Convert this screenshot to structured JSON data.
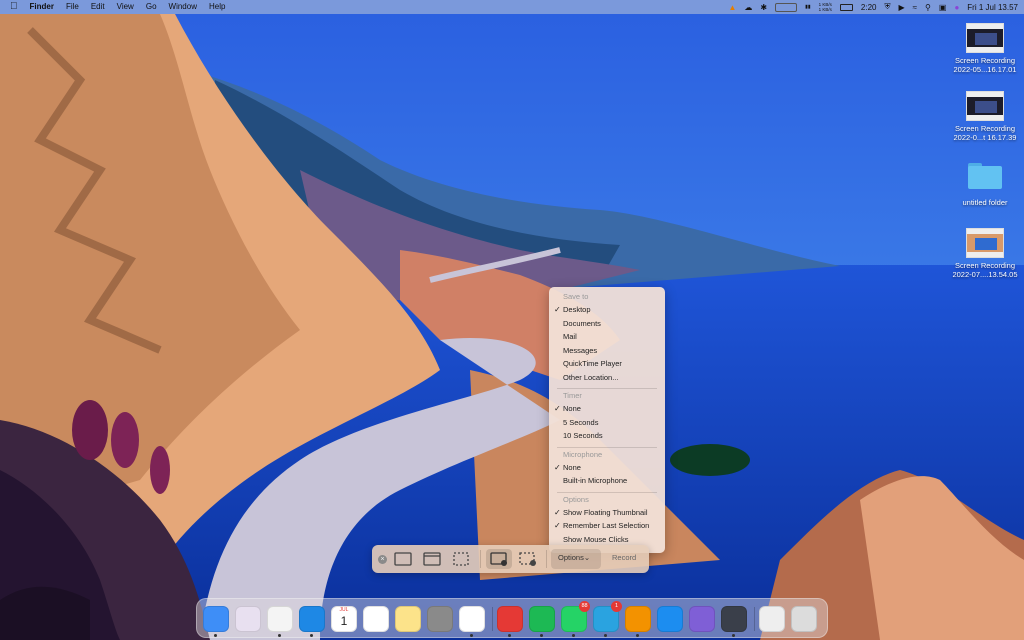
{
  "menubar": {
    "app_name": "Finder",
    "menus": [
      "File",
      "Edit",
      "View",
      "Go",
      "Window",
      "Help"
    ],
    "status": {
      "net_up": "1 KB/s",
      "net_down": "1 KB/s",
      "battery_time": "2:20",
      "datetime": "Fri 1 Jul  13.57"
    }
  },
  "desktop_items": [
    {
      "line1": "Screen Recording",
      "line2": "2022-05...16.17.01",
      "kind": "recording"
    },
    {
      "line1": "Screen Recording",
      "line2": "2022-0...t 16.17.39",
      "kind": "recording"
    },
    {
      "line1": "untitled folder",
      "line2": "",
      "kind": "folder"
    },
    {
      "line1": "Screen Recording",
      "line2": "2022-07....13.54.05",
      "kind": "recording"
    }
  ],
  "options_menu": {
    "save_to": {
      "header": "Save to",
      "items": [
        "Desktop",
        "Documents",
        "Mail",
        "Messages",
        "QuickTime Player",
        "Other Location..."
      ],
      "checked": "Desktop"
    },
    "timer": {
      "header": "Timer",
      "items": [
        "None",
        "5 Seconds",
        "10 Seconds"
      ],
      "checked": "None"
    },
    "microphone": {
      "header": "Microphone",
      "items": [
        "None",
        "Built-in Microphone"
      ],
      "checked": "None"
    },
    "options": {
      "header": "Options",
      "items": [
        "Show Floating Thumbnail",
        "Remember Last Selection",
        "Show Mouse Clicks"
      ],
      "checked": [
        "Show Floating Thumbnail",
        "Remember Last Selection"
      ]
    }
  },
  "toolbar": {
    "options_label": "Options⌄",
    "record_label": "Record"
  },
  "dock": {
    "apps": [
      {
        "name": "finder-icon",
        "color": "#3e8ef7",
        "running": true
      },
      {
        "name": "launchpad-icon",
        "color": "#e8e0f0",
        "running": false
      },
      {
        "name": "chrome-icon",
        "color": "#f4f4f4",
        "running": true
      },
      {
        "name": "safari-icon",
        "color": "#1e88e5",
        "running": true
      },
      {
        "name": "calendar-icon",
        "color": "#ffffff",
        "running": false,
        "text_month": "JUL",
        "text_day": "1"
      },
      {
        "name": "reminders-icon",
        "color": "#ffffff",
        "running": false
      },
      {
        "name": "notes-icon",
        "color": "#fce38a",
        "running": false
      },
      {
        "name": "system-preferences-icon",
        "color": "#8a8a8a",
        "running": false
      },
      {
        "name": "notion-icon",
        "color": "#ffffff",
        "running": true
      },
      {
        "name": "brave-icon",
        "color": "#e53935",
        "running": true
      },
      {
        "name": "spotify-icon",
        "color": "#1db954",
        "running": true
      },
      {
        "name": "whatsapp-icon",
        "color": "#25d366",
        "running": true,
        "badge": "88"
      },
      {
        "name": "telegram-icon",
        "color": "#2aa3e0",
        "running": true,
        "badge": "1"
      },
      {
        "name": "vlc-icon",
        "color": "#f39200",
        "running": true
      },
      {
        "name": "app-store-icon",
        "color": "#1c8df0",
        "running": false
      },
      {
        "name": "pixelmator-icon",
        "color": "#7f5fd6",
        "running": false
      },
      {
        "name": "quicktime-icon",
        "color": "#3a3f4a",
        "running": true
      },
      {
        "name": "downloads-stack-icon",
        "color": "#eeeeee",
        "running": false
      },
      {
        "name": "trash-icon",
        "color": "#dcdcdc",
        "running": false
      }
    ]
  }
}
